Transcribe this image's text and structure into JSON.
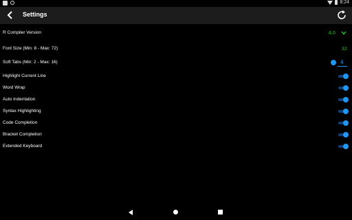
{
  "status_bar": {
    "time": "8:24"
  },
  "toolbar": {
    "title": "Settings"
  },
  "settings": [
    {
      "label": "R Compiler Version",
      "value": "4.0",
      "control": "dropdown"
    },
    {
      "label": "Font Size (Min: 8 - Max: 72)",
      "value": "32",
      "control": "number"
    },
    {
      "label": "Soft Tabs (Min: 2 - Max: 16)",
      "value": "4",
      "control": "toggle-number",
      "toggle_on": true
    },
    {
      "label": "Highlight Current Line",
      "control": "switch",
      "on": true
    },
    {
      "label": "Word Wrap",
      "control": "switch",
      "on": true
    },
    {
      "label": "Auto Indentation",
      "control": "switch",
      "on": true
    },
    {
      "label": "Syntax Highlighting",
      "control": "switch",
      "on": true
    },
    {
      "label": "Code Completion",
      "control": "switch",
      "on": true
    },
    {
      "label": "Bracket Completion",
      "control": "switch",
      "on": true
    },
    {
      "label": "Extended Keyboard",
      "control": "switch",
      "on": true
    }
  ],
  "colors": {
    "accent": "#2196f3",
    "value_green": "#1db91d",
    "toolbar_bg": "#1c1c1c",
    "background": "#000000"
  },
  "icons": {
    "back": "arrow-back-icon",
    "refresh": "refresh-icon",
    "dropdown": "chevron-down-icon",
    "nav_back": "nav-back-icon",
    "nav_home": "nav-home-icon",
    "nav_recents": "nav-recents-icon"
  }
}
